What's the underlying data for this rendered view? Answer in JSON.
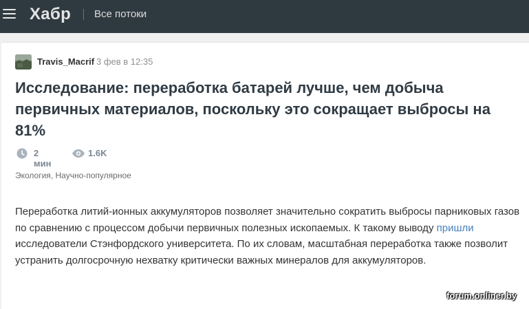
{
  "header": {
    "menu_icon": "hamburger-icon",
    "logo": "Хабр",
    "flows_label": "Все потоки",
    "background": "#2f3a40"
  },
  "article": {
    "author": "Travis_Macrif",
    "date": "3 фев в 12:35",
    "title": "Исследование: переработка батарей лучше, чем добыча первичных материалов, поскольку это сокращает выбросы на 81%",
    "reading_time": "2 мин",
    "reading_time_icon": "clock-icon",
    "views": "1.6K",
    "views_icon": "eye-icon",
    "hubs": [
      "Экология",
      "Научно-популярное"
    ],
    "hub_separator": ", ",
    "body": {
      "part1": "Переработка литий-ионных аккумуляторов позволяет значительно сократить выбросы парниковых газов по сравнению с процессом добычи первичных полезных ископаемых. К такому выводу ",
      "link": "пришли",
      "part2": " исследователи Стэнфордского университета. По их словам, масштабная переработка также позволит устранить долгосрочную нехватку критически важных минералов для аккумуляторов."
    },
    "link_color": "#4880b9"
  },
  "watermark": "forum.onliner.by"
}
